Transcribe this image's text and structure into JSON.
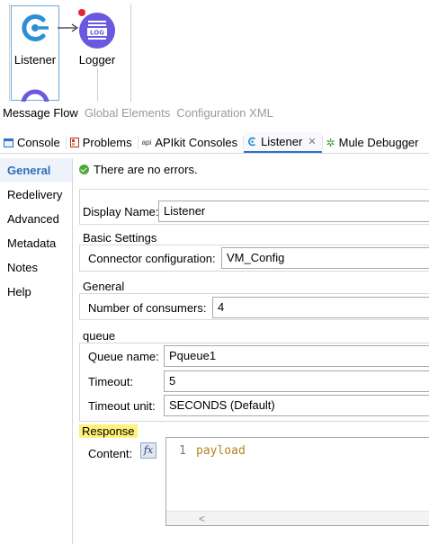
{
  "flow": {
    "listener_label": "Listener",
    "logger_label": "Logger",
    "logger_icon_text": "LOG"
  },
  "editor_tabs": [
    "Message Flow",
    "Global Elements",
    "Configuration XML"
  ],
  "view_tabs": {
    "console": "Console",
    "problems": "Problems",
    "apikit_prefix": "api",
    "apikit": "APIkit Consoles",
    "listener": "Listener",
    "mule_debugger": "Mule Debugger"
  },
  "nav": [
    "General",
    "Redelivery",
    "Advanced",
    "Metadata",
    "Notes",
    "Help"
  ],
  "status": "There are no errors.",
  "form": {
    "display_name_label": "Display Name:",
    "display_name_value": "Listener",
    "basic_settings_title": "Basic Settings",
    "connector_config_label": "Connector configuration:",
    "connector_config_value": "VM_Config",
    "general_title": "General",
    "consumers_label": "Number of consumers:",
    "consumers_value": "4",
    "queue_title": "queue",
    "queue_name_label": "Queue name:",
    "queue_name_value": "Pqueue1",
    "timeout_label": "Timeout:",
    "timeout_value": "5",
    "timeout_unit_label": "Timeout unit:",
    "timeout_unit_value": "SECONDS (Default)",
    "response_title": "Response",
    "content_label": "Content:",
    "fx_label": "fx",
    "code_line_number": "1",
    "code_text": "payload",
    "scroll_left": "<"
  },
  "colors": {
    "accent": "#2b72c9",
    "listener_icon": "#2b8fd6",
    "logger_icon": "#6a59e0",
    "error_dot": "#e0243a",
    "ok_green": "#4fa83d",
    "highlight": "#fff27a",
    "code_color": "#b5831f"
  }
}
